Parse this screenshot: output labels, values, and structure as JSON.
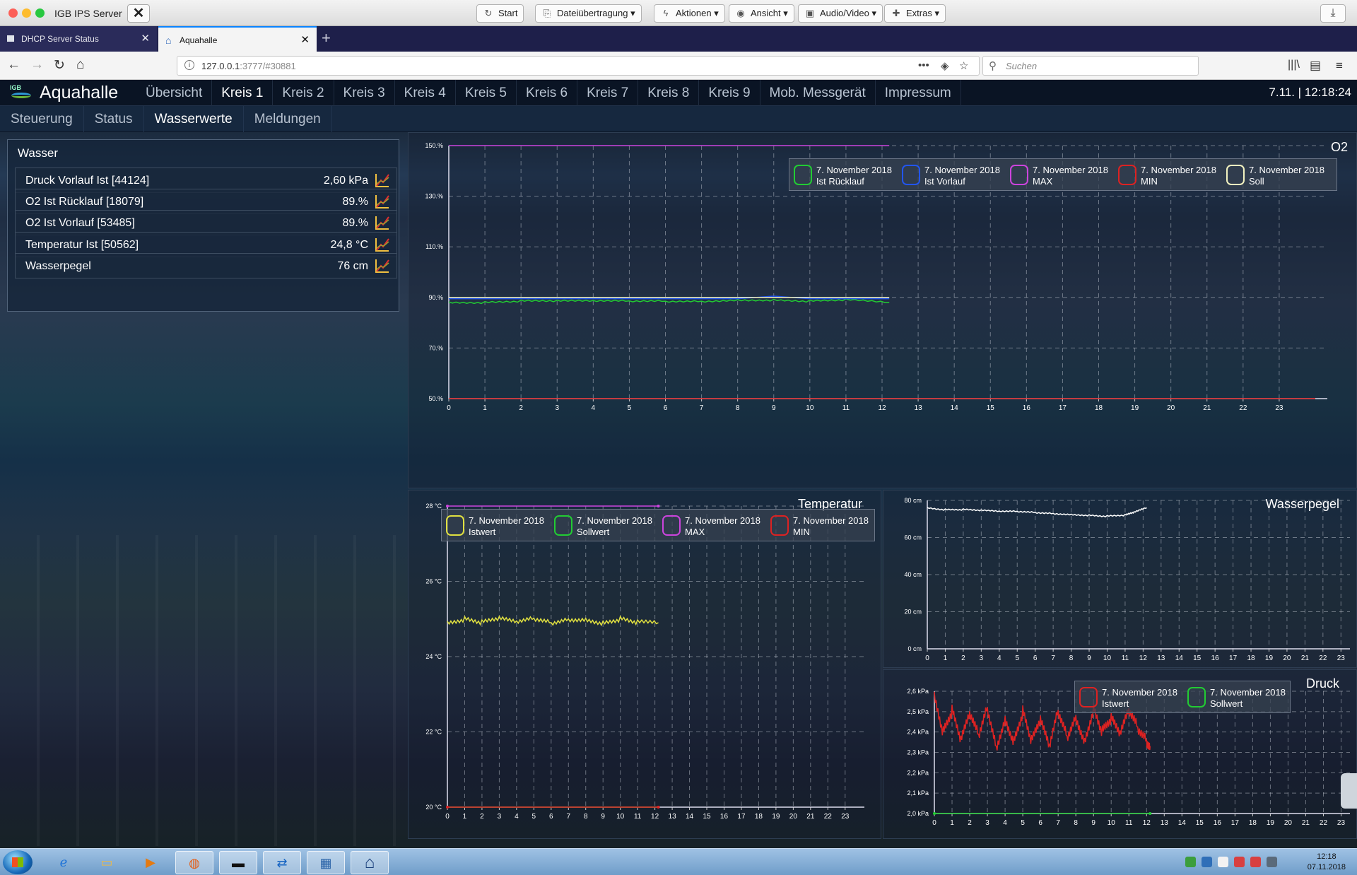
{
  "remote_desktop": {
    "title": "IGB IPS Server",
    "buttons": [
      {
        "icon": "refresh-icon",
        "label": "Start"
      },
      {
        "icon": "file-transfer-icon",
        "label": "Dateiübertragung"
      },
      {
        "icon": "bolt-icon",
        "label": "Aktionen"
      },
      {
        "icon": "eye-icon",
        "label": "Ansicht"
      },
      {
        "icon": "media-icon",
        "label": "Audio/Video"
      },
      {
        "icon": "extras-icon",
        "label": "Extras"
      }
    ]
  },
  "browser": {
    "tabs": [
      {
        "label": "DHCP Server Status",
        "active": false
      },
      {
        "label": "Aquahalle",
        "active": true
      }
    ],
    "url_host": "127.0.0.1",
    "url_rest": ":3777/#30881",
    "search_placeholder": "Suchen"
  },
  "app": {
    "title": "Aquahalle",
    "logo_text": "IGB",
    "clock": "7.11. | 12:18:24",
    "main_nav": [
      "Übersicht",
      "Kreis 1",
      "Kreis 2",
      "Kreis 3",
      "Kreis 4",
      "Kreis 5",
      "Kreis 6",
      "Kreis 7",
      "Kreis 8",
      "Kreis 9",
      "Mob. Messgerät",
      "Impressum"
    ],
    "main_nav_active": 1,
    "sub_nav": [
      "Steuerung",
      "Status",
      "Wasserwerte",
      "Meldungen"
    ],
    "sub_nav_active": 2
  },
  "wasser": {
    "title": "Wasser",
    "rows": [
      {
        "label": "Druck Vorlauf Ist [44124]",
        "value": "2,60 kPa"
      },
      {
        "label": "O2 Ist Rücklauf [18079]",
        "value": "89.%"
      },
      {
        "label": "O2 Ist Vorlauf [53485]",
        "value": "89.%"
      },
      {
        "label": "Temperatur Ist [50562]",
        "value": "24,8 °C"
      },
      {
        "label": "Wasserpegel",
        "value": "76 cm"
      }
    ]
  },
  "chart_data": [
    {
      "type": "line",
      "title": "O2",
      "x_ticks": [
        "0",
        "1",
        "2",
        "3",
        "4",
        "5",
        "6",
        "7",
        "8",
        "9",
        "10",
        "11",
        "12",
        "13",
        "14",
        "15",
        "16",
        "17",
        "18",
        "19",
        "20",
        "21",
        "22",
        "23"
      ],
      "xlim": [
        0,
        24
      ],
      "ylim": [
        50,
        150
      ],
      "y_ticks": [
        "50.%",
        "70.%",
        "90.%",
        "110.%",
        "130.%",
        "150.%"
      ],
      "y_tick_values": [
        50,
        70,
        90,
        110,
        130,
        150
      ],
      "grid": true,
      "legend_position": "top-right",
      "series": [
        {
          "date": "7. November 2018",
          "name": "Ist Rücklauf",
          "color": "#22cc33",
          "x": [
            0,
            1,
            2,
            3,
            4,
            5,
            6,
            7,
            8,
            9,
            10,
            11,
            12.2
          ],
          "values": [
            88,
            88,
            88.5,
            88.5,
            88.5,
            88.5,
            88.5,
            88.5,
            89,
            89,
            88.5,
            89,
            88
          ]
        },
        {
          "date": "7. November 2018",
          "name": "Ist Vorlauf",
          "color": "#2255ee",
          "x": [
            0,
            2,
            4,
            6,
            8,
            9,
            10,
            12.2
          ],
          "values": [
            89.5,
            89.5,
            89.5,
            89.5,
            89.5,
            90.5,
            89.5,
            89.5
          ]
        },
        {
          "date": "7. November 2018",
          "name": "MAX",
          "color": "#cc44dd",
          "x": [
            0,
            12.2
          ],
          "values": [
            150,
            150
          ]
        },
        {
          "date": "7. November 2018",
          "name": "MIN",
          "color": "#dd2222",
          "x": [
            0,
            24
          ],
          "values": [
            50,
            50
          ]
        },
        {
          "date": "7. November 2018",
          "name": "Soll",
          "color": "#f2f2c0",
          "x": [
            0,
            12.2
          ],
          "values": [
            90,
            90
          ]
        }
      ]
    },
    {
      "type": "line",
      "title": "Temperatur",
      "x_ticks": [
        "0",
        "1",
        "2",
        "3",
        "4",
        "5",
        "6",
        "7",
        "8",
        "9",
        "10",
        "11",
        "12",
        "13",
        "14",
        "15",
        "16",
        "17",
        "18",
        "19",
        "20",
        "21",
        "22",
        "23"
      ],
      "xlim": [
        0,
        23.5
      ],
      "ylim": [
        20,
        28
      ],
      "y_ticks": [
        "20 °C",
        "22 °C",
        "24 °C",
        "26 °C",
        "28 °C"
      ],
      "y_tick_values": [
        20,
        22,
        24,
        26,
        28
      ],
      "grid": true,
      "legend_position": "top-left",
      "series": [
        {
          "date": "7. November 2018",
          "name": "Istwert",
          "color": "#e0e040",
          "x": [
            0,
            1,
            2,
            3,
            4,
            5,
            6,
            7,
            8,
            9,
            10,
            11,
            12.2
          ],
          "values": [
            24.9,
            25,
            24.9,
            25,
            24.9,
            25,
            24.9,
            25,
            25,
            24.9,
            25,
            24.9,
            24.9
          ]
        },
        {
          "date": "7. November 2018",
          "name": "Sollwert",
          "color": "#22cc33",
          "x": [
            0,
            12.2
          ],
          "values": [
            20,
            20
          ]
        },
        {
          "date": "7. November 2018",
          "name": "MAX",
          "color": "#cc44dd",
          "x": [
            0,
            12.2
          ],
          "values": [
            28,
            28
          ]
        },
        {
          "date": "7. November 2018",
          "name": "MIN",
          "color": "#dd2222",
          "x": [
            0,
            12.2
          ],
          "values": [
            20,
            20
          ]
        }
      ]
    },
    {
      "type": "line",
      "title": "Wasserpegel",
      "x_ticks": [
        "0",
        "1",
        "2",
        "3",
        "4",
        "5",
        "6",
        "7",
        "8",
        "9",
        "10",
        "11",
        "12",
        "13",
        "14",
        "15",
        "16",
        "17",
        "18",
        "19",
        "20",
        "21",
        "22",
        "23"
      ],
      "xlim": [
        0,
        23.5
      ],
      "ylim": [
        0,
        80
      ],
      "y_ticks": [
        "0 cm",
        "20 cm",
        "40 cm",
        "60 cm",
        "80 cm"
      ],
      "y_tick_values": [
        0,
        20,
        40,
        60,
        80
      ],
      "grid": true,
      "series": [
        {
          "color": "#ffffff",
          "x": [
            0,
            1,
            2,
            3,
            4,
            5,
            6,
            7,
            8,
            9,
            10,
            11,
            11.5,
            12.2
          ],
          "values": [
            76,
            75,
            75,
            74.5,
            74,
            74,
            73.5,
            73,
            72.5,
            72,
            71.5,
            72,
            73.5,
            76
          ]
        }
      ]
    },
    {
      "type": "line",
      "title": "Druck",
      "x_ticks": [
        "0",
        "1",
        "2",
        "3",
        "4",
        "5",
        "6",
        "7",
        "8",
        "9",
        "10",
        "11",
        "12",
        "13",
        "14",
        "15",
        "16",
        "17",
        "18",
        "19",
        "20",
        "21",
        "22",
        "23"
      ],
      "xlim": [
        0,
        23.5
      ],
      "ylim": [
        2.0,
        2.6
      ],
      "y_ticks": [
        "2,0 kPa",
        "2,1 kPa",
        "2,2 kPa",
        "2,3 kPa",
        "2,4 kPa",
        "2,5 kPa",
        "2,6 kPa"
      ],
      "y_tick_values": [
        2.0,
        2.1,
        2.2,
        2.3,
        2.4,
        2.5,
        2.6
      ],
      "grid": true,
      "legend_position": "top-right",
      "series": [
        {
          "date": "7. November 2018",
          "name": "Istwert",
          "color": "#dd2222",
          "x": [
            0,
            0.5,
            1,
            1.5,
            2,
            2.5,
            3,
            3.5,
            4,
            4.5,
            5,
            5.5,
            6,
            6.5,
            7,
            7.5,
            8,
            8.5,
            9,
            9.5,
            10,
            10.5,
            11,
            11.5,
            12,
            12.2
          ],
          "values": [
            2.58,
            2.4,
            2.5,
            2.35,
            2.48,
            2.38,
            2.52,
            2.33,
            2.47,
            2.36,
            2.5,
            2.35,
            2.45,
            2.32,
            2.5,
            2.38,
            2.48,
            2.36,
            2.52,
            2.4,
            2.46,
            2.38,
            2.5,
            2.42,
            2.36,
            2.33
          ]
        },
        {
          "date": "7. November 2018",
          "name": "Sollwert",
          "color": "#22cc33",
          "x": [
            0,
            12.2
          ],
          "values": [
            2.0,
            2.0
          ]
        }
      ]
    }
  ],
  "taskbar": {
    "apps": [
      "ie-icon",
      "explorer-icon",
      "media-player-icon",
      "firefox-icon",
      "cmd-icon",
      "teamviewer-icon",
      "remote-icon",
      "home-icon"
    ],
    "time": "12:18",
    "date": "07.11.2018"
  }
}
